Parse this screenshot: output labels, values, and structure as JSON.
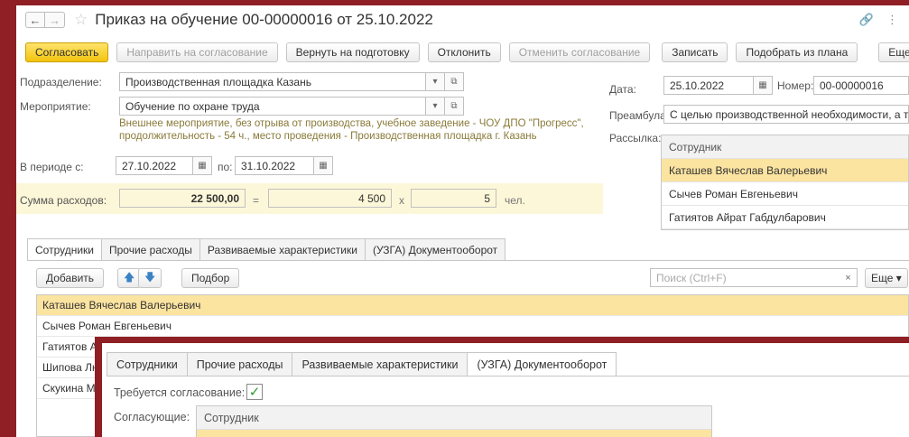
{
  "window": {
    "title": "Приказ на обучение 00-00000016 от 25.10.2022",
    "back_glyph": "←",
    "fwd_glyph": "→",
    "star_glyph": "☆",
    "link_glyph": "🔗",
    "more_glyph": "⋮"
  },
  "toolbar": {
    "approve": "Согласовать",
    "send_for_approval": "Направить на согласование",
    "return_to_prep": "Вернуть на подготовку",
    "reject": "Отклонить",
    "cancel_approval": "Отменить согласование",
    "save": "Записать",
    "pick_from_plan": "Подобрать из плана",
    "more": "Еще"
  },
  "form": {
    "division_label": "Подразделение:",
    "division_value": "Производственная площадка Казань",
    "event_label": "Мероприятие:",
    "event_value": "Обучение по охране труда",
    "event_note": "Внешнее мероприятие, без отрыва от производства, учебное заведение - ЧОУ ДПО \"Прогресс\", продолжительность - 54 ч., место проведения - Производственная площадка г. Казань",
    "period_label": "В периоде с:",
    "period_from": "27.10.2022",
    "period_to_label": "по:",
    "period_to": "31.10.2022",
    "cost_label": "Сумма расходов:",
    "cost_total": "22 500,00",
    "eq_sign": "=",
    "cost_per": "4 500",
    "times_sign": "x",
    "people_count": "5",
    "people_unit": "чел.",
    "date_label": "Дата:",
    "date_value": "25.10.2022",
    "number_label": "Номер:",
    "number_value": "00-00000016",
    "preamble_label": "Преамбула:",
    "preamble_value": "С целью производственной необходимости, а такж",
    "mailing_label": "Рассылка:",
    "mailing_header": "Сотрудник",
    "mailing_rows": [
      "Каташев Вячеслав Валерьевич",
      "Сычев Роман Евгеньевич",
      "Гатиятов Айрат Габдулбарович"
    ]
  },
  "tabs": [
    "Сотрудники",
    "Прочие расходы",
    "Развиваемые характеристики",
    "(УЗГА) Документооборот"
  ],
  "employees_toolbar": {
    "add": "Добавить",
    "up_glyph": "🡅",
    "down_glyph": "🡇",
    "pick": "Подбор",
    "search_placeholder": "Поиск (Ctrl+F)",
    "clear_glyph": "×",
    "more": "Еще ▾"
  },
  "employees": [
    "Каташев Вячеслав Валерьевич",
    "Сычев Роман Евгеньевич",
    "Гатиятов Ай",
    "Шипова Лю",
    "Скукина М"
  ],
  "popup": {
    "tabs": [
      "Сотрудники",
      "Прочие расходы",
      "Развиваемые характеристики",
      "(УЗГА) Документооборот"
    ],
    "approval_required_label": "Требуется согласование:",
    "check_glyph": "✓",
    "approvers_label": "Согласующие:",
    "approvers_header": "Сотрудник"
  }
}
